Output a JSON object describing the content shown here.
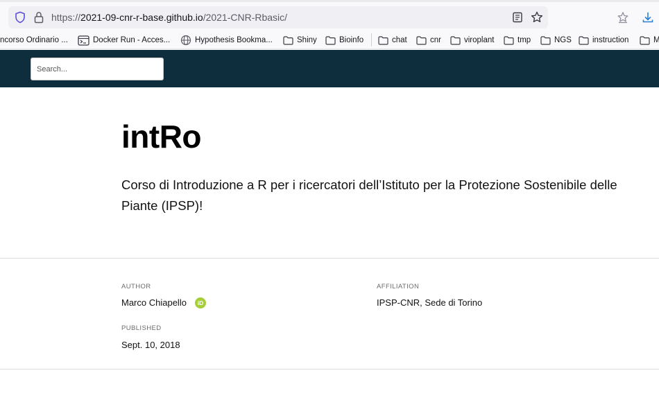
{
  "browser": {
    "url": {
      "scheme": "https://",
      "host": "2021-09-cnr-r-base.github.io",
      "path": "/2021-CNR-Rbasic/"
    },
    "bookmarks": [
      {
        "label": "ncorso Ordinario ...",
        "icon": "none"
      },
      {
        "label": "Docker Run - Acces...",
        "icon": "terminal-icon"
      },
      {
        "label": "Hypothesis Bookma...",
        "icon": "globe-icon"
      },
      {
        "label": "Shiny",
        "icon": "folder-icon"
      },
      {
        "label": "Bioinfo",
        "icon": "folder-icon"
      },
      {
        "label": "chat",
        "icon": "folder-icon"
      },
      {
        "label": "cnr",
        "icon": "folder-icon"
      },
      {
        "label": "viroplant",
        "icon": "folder-icon"
      },
      {
        "label": "tmp",
        "icon": "folder-icon"
      },
      {
        "label": "NGS",
        "icon": "folder-icon"
      },
      {
        "label": "instruction",
        "icon": "folder-icon"
      },
      {
        "label": "M",
        "icon": "folder-icon"
      }
    ]
  },
  "header": {
    "search_placeholder": "Search...",
    "background": "#0f2e3d"
  },
  "article": {
    "title": "intRo",
    "description": "Corso di Introduzione a R per i ricercatori dell’Istituto per la Protezione Sostenibile delle Piante (IPSP)!",
    "author_label": "AUTHOR",
    "author": "Marco Chiapello",
    "orcid_badge": "iD",
    "affiliation_label": "AFFILIATION",
    "affiliation": "IPSP-CNR, Sede di Torino",
    "published_label": "PUBLISHED",
    "published": "Sept. 10, 2018"
  }
}
